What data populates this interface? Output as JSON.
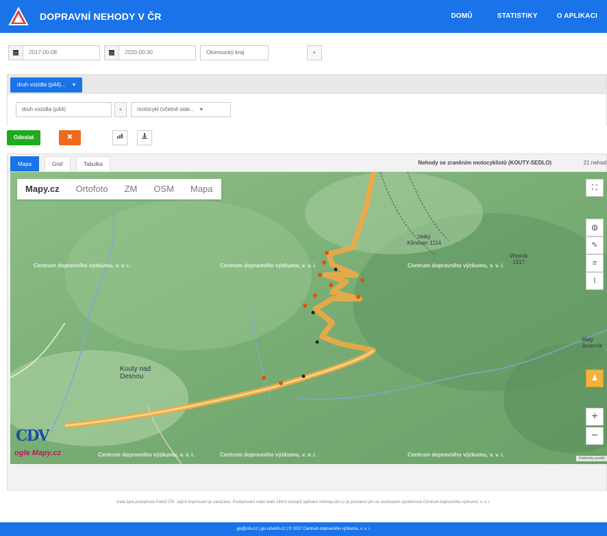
{
  "header": {
    "title": "DOPRAVNÍ NEHODY V ČR",
    "nav": [
      "DOMŮ",
      "STATISTIKY",
      "O APLIKACI"
    ]
  },
  "filters": {
    "date_from": "2017-00-08",
    "date_to": "2020-00-30",
    "region": "Olomoucký kraj",
    "more_button": "+"
  },
  "panel": {
    "chip_label": "druh vozidla (p44)...",
    "select1": "druh vozidla (p44)",
    "select1_btn": "+",
    "select2": "motocykl (včetně side..."
  },
  "actions": {
    "submit": "Odeslat",
    "clear": "✖"
  },
  "map": {
    "tabs": [
      "Mapa",
      "Graf",
      "Tabulka"
    ],
    "title": "Nehody se zraněním motocyklistů (KOUTY-SEDLO)",
    "count": "21 nehod",
    "layers": [
      "Mapy.cz",
      "Ortofoto",
      "ZM",
      "OSM",
      "Mapa"
    ],
    "watermark": "Centrum dopravního výzkumu, v. v. i.",
    "places": {
      "kouty": "Kouty nad Desnou",
      "velky_klinovec": "Velký Klínovec 1114",
      "vresnik": "Vřesník 1317",
      "malý": "Malý Jezerník"
    },
    "attribution": "Podmínky použití"
  },
  "footer": {
    "note": "Data byla poskytnuta Policií ČR. Jejich kopírování je zakázáno. Poskytování nebo další šíření výstupů aplikace nehody.cdv.cz je povoleno jen se souhlasem společnosti Centrum dopravního výzkumu, v. v. i.",
    "bar": "gis@cdv.cz | gis.cdvinfo.cz | © 2017 Centrum dopravního výzkumu, v. v. i."
  }
}
